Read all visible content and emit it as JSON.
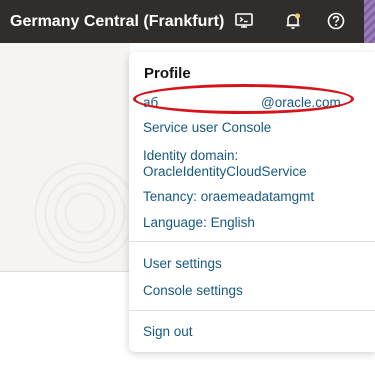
{
  "header": {
    "region": "Germany Central (Frankfurt)",
    "icons": [
      "cloud-shell-icon",
      "bell-icon",
      "help-icon"
    ]
  },
  "profile": {
    "title": "Profile",
    "email_user": "aб",
    "email_domain": "@oracle.com",
    "service_user_console": "Service user Console",
    "identity_domain_label": "Identity domain:",
    "identity_domain_value": "OracleIdentityCloudService",
    "tenancy": "Tenancy: oraemeadatamgmt",
    "language": "Language: English",
    "user_settings": "User settings",
    "console_settings": "Console settings",
    "sign_out": "Sign out"
  },
  "colors": {
    "topbar": "#312d2a",
    "link": "#175a7f",
    "highlight": "#d6131b"
  }
}
